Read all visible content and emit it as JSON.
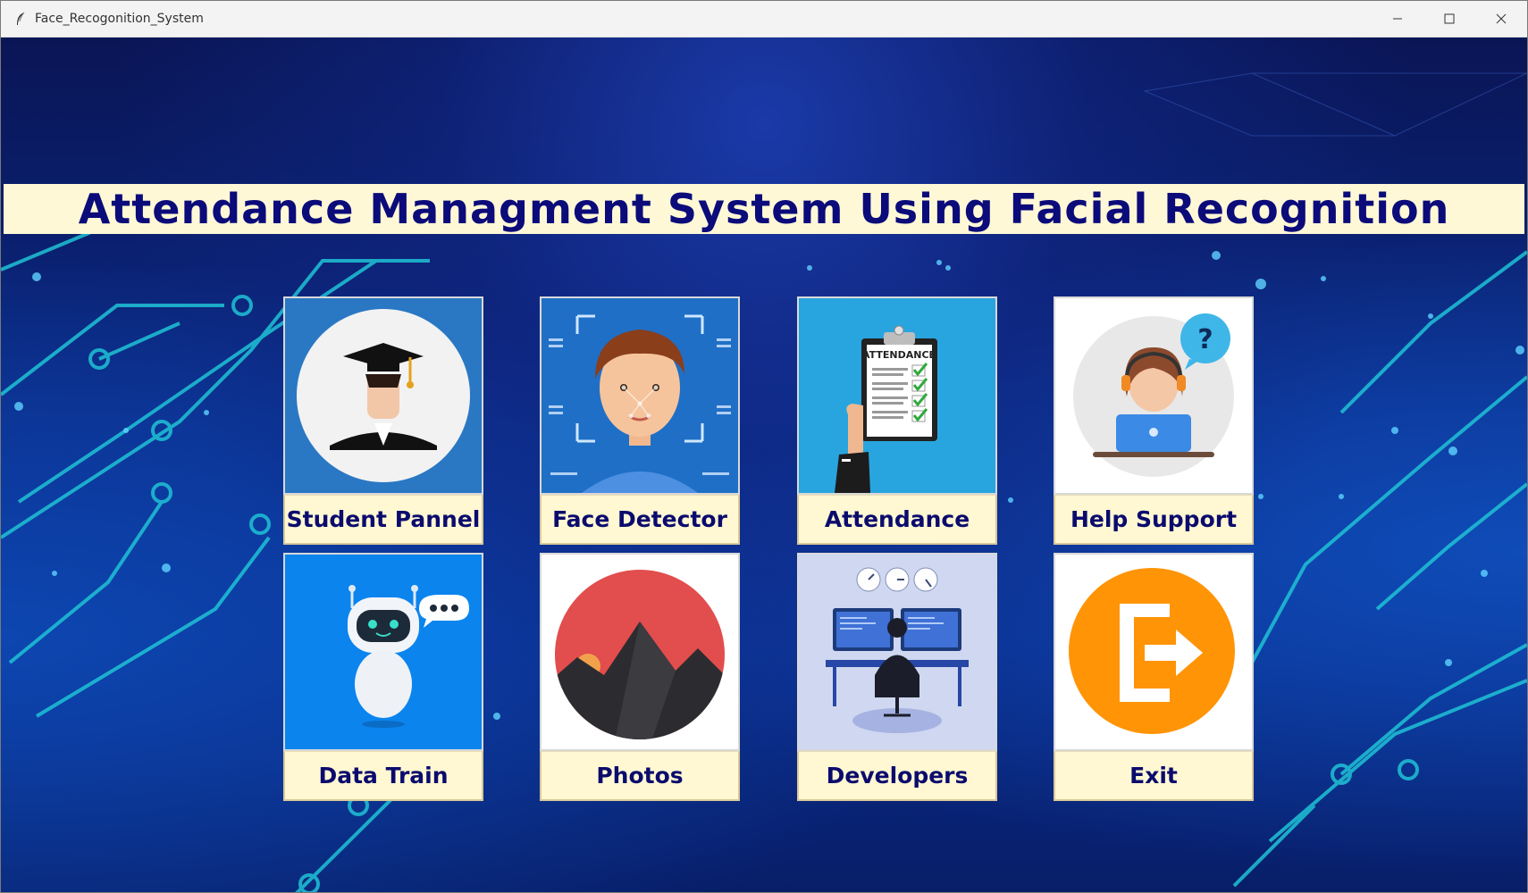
{
  "window": {
    "title": "Face_Recogonition_System",
    "controls": [
      "minimize-icon",
      "maximize-icon",
      "close-icon"
    ]
  },
  "banner": {
    "title": "Attendance Managment System Using Facial Recognition",
    "background": "#fff8d6",
    "color": "#0b0b7a"
  },
  "tiles": [
    {
      "label": "Student Pannel",
      "icon": "student-icon"
    },
    {
      "label": "Face Detector",
      "icon": "face-detector-icon"
    },
    {
      "label": "Attendance",
      "icon": "attendance-icon"
    },
    {
      "label": "Help Support",
      "icon": "help-support-icon"
    },
    {
      "label": "Data Train",
      "icon": "robot-icon"
    },
    {
      "label": "Photos",
      "icon": "photos-icon"
    },
    {
      "label": "Developers",
      "icon": "developers-icon"
    },
    {
      "label": "Exit",
      "icon": "exit-icon"
    }
  ],
  "colors": {
    "label_bg": "#fff8d2",
    "label_text": "#0b0b6e",
    "background": "#0a2c8c",
    "circuit": "#22c4d8"
  },
  "annotation": "Attendance tile clipboard reads ATTENDANCE"
}
